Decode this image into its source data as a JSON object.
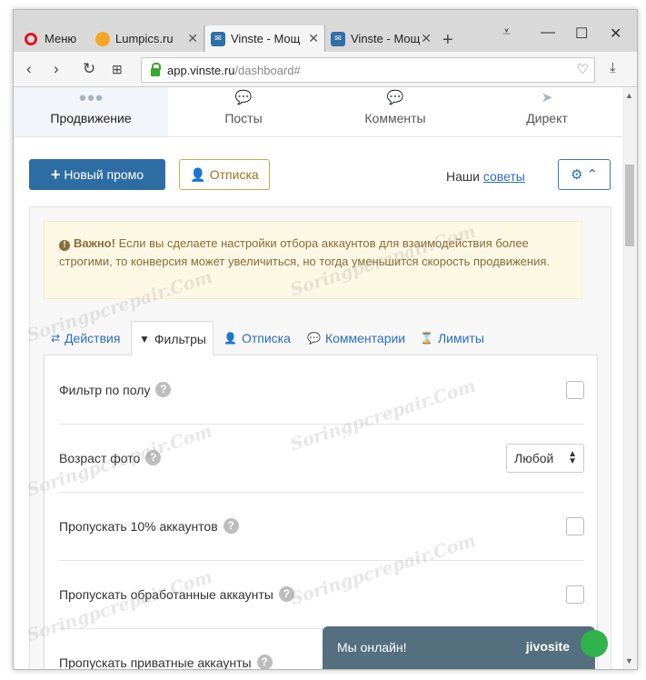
{
  "browser": {
    "menu_label": "Меню",
    "tabs": [
      {
        "label": "Lumpics.ru"
      },
      {
        "label": "Vinste - Мощ"
      },
      {
        "label": "Vinste - Мощ"
      }
    ],
    "new_tab": "+",
    "url_host": "app.vinste.ru",
    "url_path": "/dashboard#"
  },
  "nav": {
    "items": [
      {
        "label": "Продвижение"
      },
      {
        "label": "Посты"
      },
      {
        "label": "Комменты"
      },
      {
        "label": "Директ"
      }
    ]
  },
  "toolbar": {
    "new_promo": "Новый промо",
    "unsubscribe": "Отписка",
    "advice_prefix": "Наши",
    "advice_link": "советы"
  },
  "alert": {
    "strong": "Важно!",
    "text": "Если вы сделаете настройки отбора аккаунтов для взаимодействия более строгими, то конверсия может увеличиться, но тогда уменьшится скорость продвижения."
  },
  "tabs": [
    {
      "label": "Действия"
    },
    {
      "label": "Фильтры"
    },
    {
      "label": "Отписка"
    },
    {
      "label": "Комментарии"
    },
    {
      "label": "Лимиты"
    }
  ],
  "filters": {
    "gender": "Фильтр по полу",
    "photo_age": "Возраст фото",
    "photo_age_value": "Любой",
    "skip10": "Пропускать 10% аккаунтов",
    "skip_processed": "Пропускать обработанные аккаунты",
    "skip_private": "Пропускать приватные аккаунты"
  },
  "chat": {
    "message": "Мы онлайн!",
    "brand": "jivosite"
  },
  "watermark": "Soringpcrepair.Com"
}
